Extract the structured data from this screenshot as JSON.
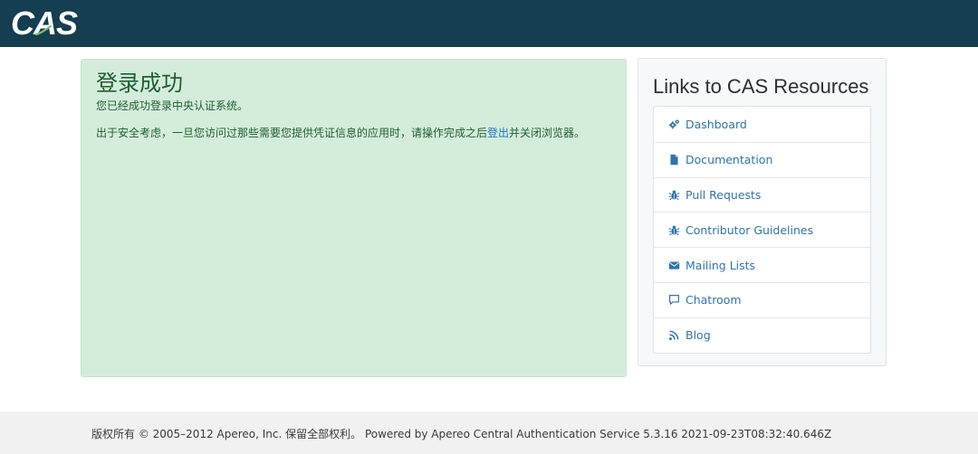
{
  "header": {
    "logo_text": "CAS",
    "bg_color": "#153e50"
  },
  "success": {
    "title": "登录成功",
    "line1": "您已经成功登录中央认证系统。",
    "line2_before": "出于安全考虑，一旦您访问过那些需要您提供凭证信息的应用时，请操作完成之后",
    "logout_link": "登出",
    "line2_after": "并关闭浏览器。",
    "bg_color": "#d4eddb"
  },
  "resources": {
    "title": "Links to CAS Resources",
    "links": [
      {
        "label": "Dashboard",
        "icon": "cogs-icon"
      },
      {
        "label": "Documentation",
        "icon": "file-icon"
      },
      {
        "label": "Pull Requests",
        "icon": "bug-icon"
      },
      {
        "label": "Contributor Guidelines",
        "icon": "bug-icon"
      },
      {
        "label": "Mailing Lists",
        "icon": "envelope-icon"
      },
      {
        "label": "Chatroom",
        "icon": "comment-icon"
      },
      {
        "label": "Blog",
        "icon": "rss-icon"
      }
    ],
    "link_color": "#2d74ac"
  },
  "footer": {
    "text": "版权所有 © 2005–2012 Apereo, Inc. 保留全部权利。 Powered by Apereo Central Authentication Service 5.3.16 2021-09-23T08:32:40.646Z"
  }
}
